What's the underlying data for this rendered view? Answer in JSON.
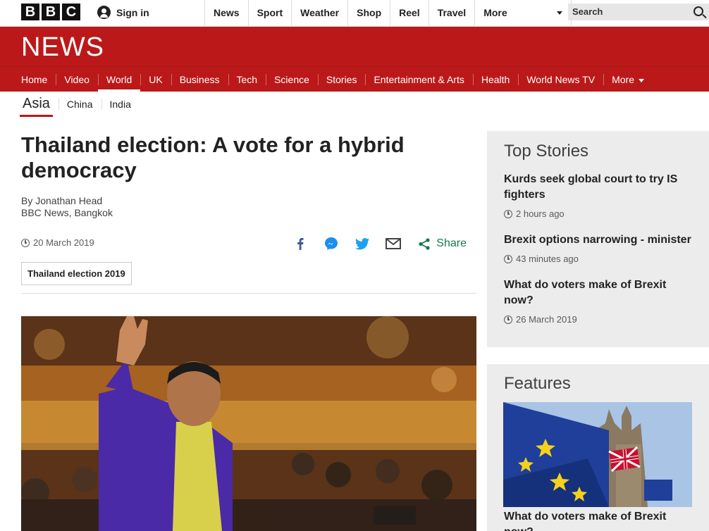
{
  "global": {
    "logo_letters": [
      "B",
      "B",
      "C"
    ],
    "sign_in": "Sign in",
    "nav": [
      "News",
      "Sport",
      "Weather",
      "Shop",
      "Reel",
      "Travel"
    ],
    "more": "More",
    "search_placeholder": "Search"
  },
  "brand": {
    "wordmark": "NEWS",
    "red": "#bb1919"
  },
  "news_nav": {
    "items": [
      "Home",
      "Video",
      "World",
      "UK",
      "Business",
      "Tech",
      "Science",
      "Stories",
      "Entertainment & Arts",
      "Health",
      "World News TV"
    ],
    "active": "World",
    "more": "More"
  },
  "sub_nav": {
    "current": "Asia",
    "items": [
      "China",
      "India"
    ]
  },
  "article": {
    "headline": "Thailand election: A vote for a hybrid democracy",
    "author": "By Jonathan Head",
    "role": "BBC News, Bangkok",
    "date": "20 March 2019",
    "share_label": "Share",
    "share_icons": [
      "facebook-icon",
      "messenger-icon",
      "twitter-icon",
      "email-icon",
      "share-icon"
    ],
    "tag": "Thailand election 2019"
  },
  "top_stories": {
    "title": "Top Stories",
    "items": [
      {
        "title": "Kurds seek global court to try IS fighters",
        "time": "2 hours ago"
      },
      {
        "title": "Brexit options narrowing - minister",
        "time": "43 minutes ago"
      },
      {
        "title": "What do voters make of Brexit now?",
        "time": "26 March 2019"
      }
    ]
  },
  "features": {
    "title": "Features",
    "items": [
      {
        "title": "What do voters make of Brexit now?"
      }
    ]
  }
}
